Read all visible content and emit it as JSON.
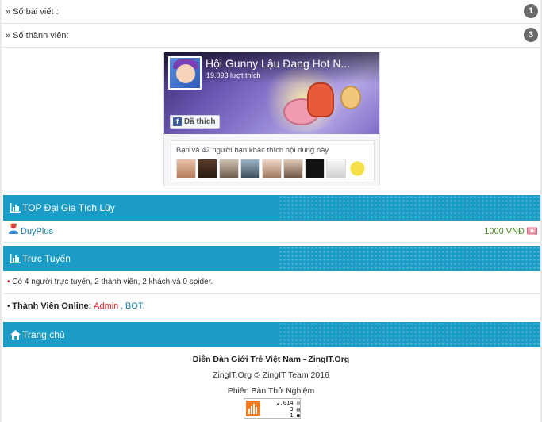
{
  "stats": {
    "posts_label": "» Số bài viết :",
    "posts_count": "1",
    "members_label": "» Số thành viên:",
    "members_count": "3"
  },
  "facebook": {
    "page_title": "Hội Gunny Lậu Đang Hot N...",
    "likes": "19.093 lượt thích",
    "like_button": "Đã thích",
    "friends_text": "Bạn và 42 người bạn khác thích nội dung này"
  },
  "sections": {
    "top_title": "TOP Đại Gia Tích Lũy",
    "online_title": "Trực Tuyến",
    "home_title": "Trang chủ"
  },
  "top_list": [
    {
      "name": "DuyPlus",
      "amount": "1000 VNĐ"
    }
  ],
  "online": {
    "summary": "Có 4 người trực tuyến, 2 thành viên, 2 khách và 0 spider.",
    "members_label": "Thành Viên Online:",
    "admin": "Admin",
    "separator": ",",
    "bot": "BOT."
  },
  "footer": {
    "site_name": "Diễn Đàn Giới Trẻ Việt Nam - ZingIT.Org",
    "copyright": "ZingIT.Org © ZingIT Team 2016",
    "version": "Phiên Bản Thử Nghiệm",
    "counter_total": "2,014",
    "counter_today": "3",
    "counter_online": "1"
  },
  "colors": {
    "section_bar": "#1a9cc6",
    "badge": "#6a6a6a",
    "link": "#1a7fa8",
    "admin": "#e02020",
    "facebook_blue": "#3b5998"
  }
}
